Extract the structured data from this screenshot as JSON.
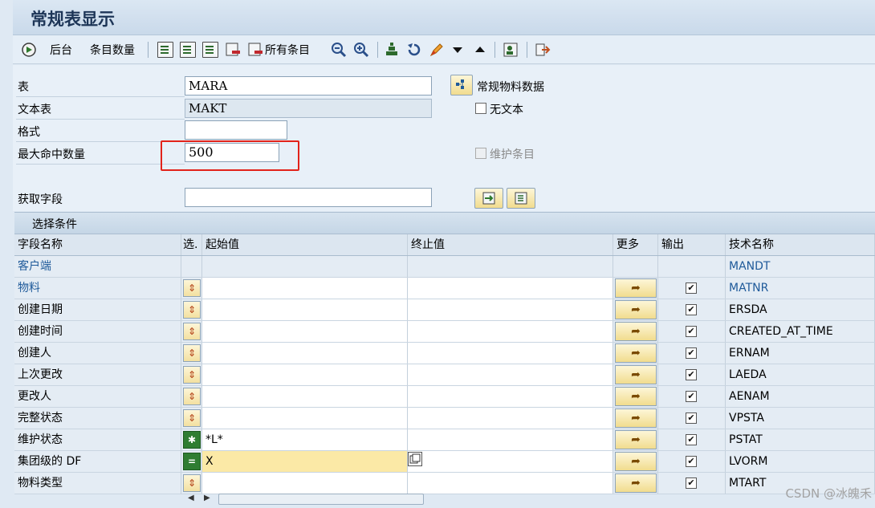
{
  "title": "常规表显示",
  "toolbar": {
    "back_label": "后台",
    "count_label": "条目数量",
    "all_entries_label": "所有条目"
  },
  "form": {
    "table_label": "表",
    "table_value": "MARA",
    "table_desc": "常规物料数据",
    "text_table_label": "文本表",
    "text_table_value": "MAKT",
    "no_text_label": "无文本",
    "format_label": "格式",
    "format_value": "",
    "max_hits_label": "最大命中数量",
    "max_hits_value": "500",
    "maintain_label": "维护条目",
    "fetch_fields_label": "获取字段",
    "fetch_fields_value": ""
  },
  "selection": {
    "section_title": "选择条件",
    "headers": {
      "name": "字段名称",
      "sel": "选.",
      "from": "起始值",
      "to": "终止值",
      "more": "更多",
      "output": "输出",
      "tech": "技术名称"
    },
    "rows": [
      {
        "name": "客户端",
        "from": "",
        "tech": "MANDT"
      },
      {
        "name": "物料",
        "from": "",
        "tech": "MATNR"
      },
      {
        "name": "创建日期",
        "from": "",
        "tech": "ERSDA"
      },
      {
        "name": "创建时间",
        "from": "",
        "tech": "CREATED_AT_TIME"
      },
      {
        "name": "创建人",
        "from": "",
        "tech": "ERNAM"
      },
      {
        "name": "上次更改",
        "from": "",
        "tech": "LAEDA"
      },
      {
        "name": "更改人",
        "from": "",
        "tech": "AENAM"
      },
      {
        "name": "完整状态",
        "from": "",
        "tech": "VPSTA"
      },
      {
        "name": "维护状态",
        "from": "*L*",
        "tech": "PSTAT"
      },
      {
        "name": "集团级的 DF",
        "from": "X",
        "tech": "LVORM"
      },
      {
        "name": "物料类型",
        "from": "",
        "tech": "MTART"
      }
    ]
  },
  "watermark": "CSDN @冰魄禾",
  "colors": {
    "accent_blue": "#1f5a9a",
    "highlight_red": "#e2231a",
    "input_yellow": "#fbe9a6"
  }
}
